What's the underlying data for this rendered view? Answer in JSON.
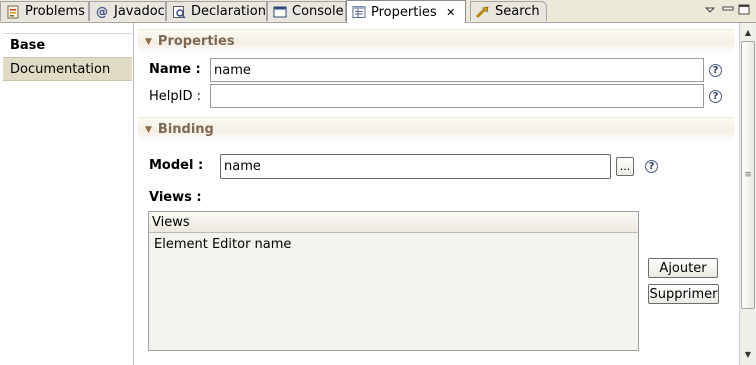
{
  "tabs": [
    {
      "label": "Problems",
      "icon": "problems-icon"
    },
    {
      "label": "Javadoc",
      "icon": "javadoc-icon"
    },
    {
      "label": "Declaration",
      "icon": "declaration-icon"
    },
    {
      "label": "Console",
      "icon": "console-icon"
    },
    {
      "label": "Properties",
      "icon": "properties-icon",
      "active": true
    },
    {
      "label": "Search",
      "icon": "search-icon"
    }
  ],
  "nav": {
    "items": [
      {
        "label": "Base",
        "selected": true
      },
      {
        "label": "Documentation",
        "selected": false
      }
    ]
  },
  "properties": {
    "section_title": "Properties",
    "name_label": "Name :",
    "name_value": "name",
    "helpid_label": "HelpID :",
    "helpid_value": ""
  },
  "binding": {
    "section_title": "Binding",
    "model_label": "Model :",
    "model_value": "name",
    "browse_label": "...",
    "views_label": "Views :",
    "views_column": "Views",
    "views_rows": [
      "Element Editor name"
    ],
    "add_label": "Ajouter",
    "remove_label": "Supprimer"
  },
  "help_glyph": "?",
  "colors": {
    "section_title": "#7d6a54",
    "nav_selected_bg": "#ffffff",
    "nav_item_bg": "#e0dbc5",
    "tabbar_bg": "#ece9d8"
  }
}
